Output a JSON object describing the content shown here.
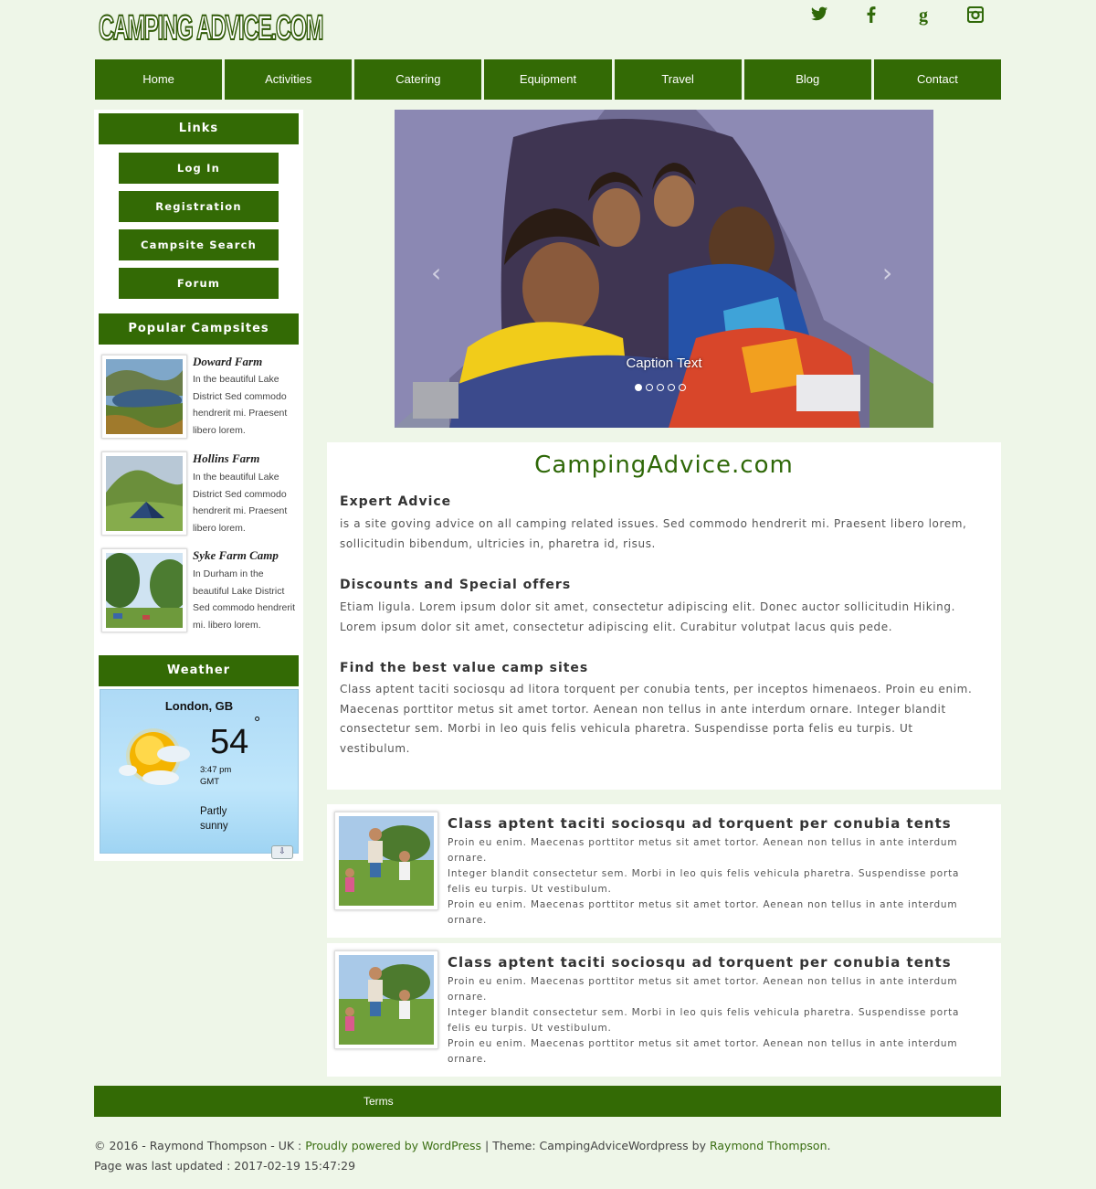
{
  "logo": {
    "text": "CAMPING ADVICE.COM"
  },
  "social": [
    {
      "name": "twitter-icon"
    },
    {
      "name": "facebook-icon"
    },
    {
      "name": "google-plus-icon",
      "glyph": "g"
    },
    {
      "name": "instagram-icon"
    }
  ],
  "nav": {
    "items": [
      "Home",
      "Activities",
      "Catering",
      "Equipment",
      "Travel",
      "Blog",
      "Contact"
    ]
  },
  "sidebar": {
    "links_heading": "Links",
    "links": [
      "Log In",
      "Registration",
      "Campsite Search",
      "Forum"
    ],
    "campsites_heading": "Popular Campsites",
    "campsites": [
      {
        "title": "Doward Farm",
        "desc": "In the beautiful Lake District Sed commodo hendrerit mi. Praesent libero lorem."
      },
      {
        "title": "Hollins Farm",
        "desc": "In the beautiful Lake District Sed commodo hendrerit mi. Praesent libero lorem."
      },
      {
        "title": "Syke Farm Camp",
        "desc": "In Durham in the beautiful Lake District Sed commodo hendrerit mi. libero lorem."
      }
    ],
    "weather_heading": "Weather",
    "weather": {
      "city": "London, GB",
      "temp": "54",
      "degree": "°",
      "time": "3:47 pm GMT",
      "condition": "Partly sunny",
      "button": "⇩"
    }
  },
  "slider": {
    "caption": "Caption Text",
    "dots": 5,
    "active_dot": 0,
    "prev": "‹",
    "next": "›"
  },
  "main": {
    "title": "CampingAdvice.com",
    "sections": [
      {
        "heading": "Expert Advice",
        "text": "is a site goving advice on all camping related issues. Sed commodo hendrerit mi. Praesent libero lorem, sollicitudin bibendum, ultricies in, pharetra id, risus."
      },
      {
        "heading": "Discounts and Special offers",
        "text": "Etiam ligula. Lorem ipsum dolor sit amet, consectetur adipiscing elit. Donec auctor sollicitudin Hiking. Lorem ipsum dolor sit amet, consectetur adipiscing elit. Curabitur volutpat lacus quis pede."
      },
      {
        "heading": "Find the best value camp sites",
        "text": "Class aptent taciti sociosqu ad litora torquent per conubia tents, per inceptos himenaeos. Proin eu enim. Maecenas porttitor metus sit amet tortor. Aenean non tellus in ante interdum ornare. Integer blandit consectetur sem. Morbi in leo quis felis vehicula pharetra. Suspendisse porta felis eu turpis. Ut vestibulum."
      }
    ]
  },
  "articles": [
    {
      "title": "Class aptent taciti sociosqu ad torquent per conubia tents",
      "p1": "Proin eu enim. Maecenas porttitor metus sit amet tortor. Aenean non tellus in ante interdum ornare.",
      "p2": "Integer blandit consectetur sem. Morbi in leo quis felis vehicula pharetra. Suspendisse porta felis eu turpis. Ut vestibulum.",
      "p3": "Proin eu enim. Maecenas porttitor metus sit amet tortor. Aenean non tellus in ante interdum ornare."
    },
    {
      "title": "Class aptent taciti sociosqu ad torquent per conubia tents",
      "p1": "Proin eu enim. Maecenas porttitor metus sit amet tortor. Aenean non tellus in ante interdum ornare.",
      "p2": "Integer blandit consectetur sem. Morbi in leo quis felis vehicula pharetra. Suspendisse porta felis eu turpis. Ut vestibulum.",
      "p3": "Proin eu enim. Maecenas porttitor metus sit amet tortor. Aenean non tellus in ante interdum ornare."
    }
  ],
  "footer": {
    "terms": "Terms",
    "copy_prefix": "© 2016 - Raymond Thompson - UK : ",
    "powered": "Proudly powered by WordPress",
    "theme_text": " | Theme: CampingAdviceWordpress by ",
    "author": "Raymond Thompson",
    "copy_suffix": ".",
    "updated": "Page was last updated : 2017-02-19 15:47:29"
  },
  "colors": {
    "brand_green": "#336a05",
    "background": "#eef6e8",
    "title_green": "#2f6808"
  }
}
